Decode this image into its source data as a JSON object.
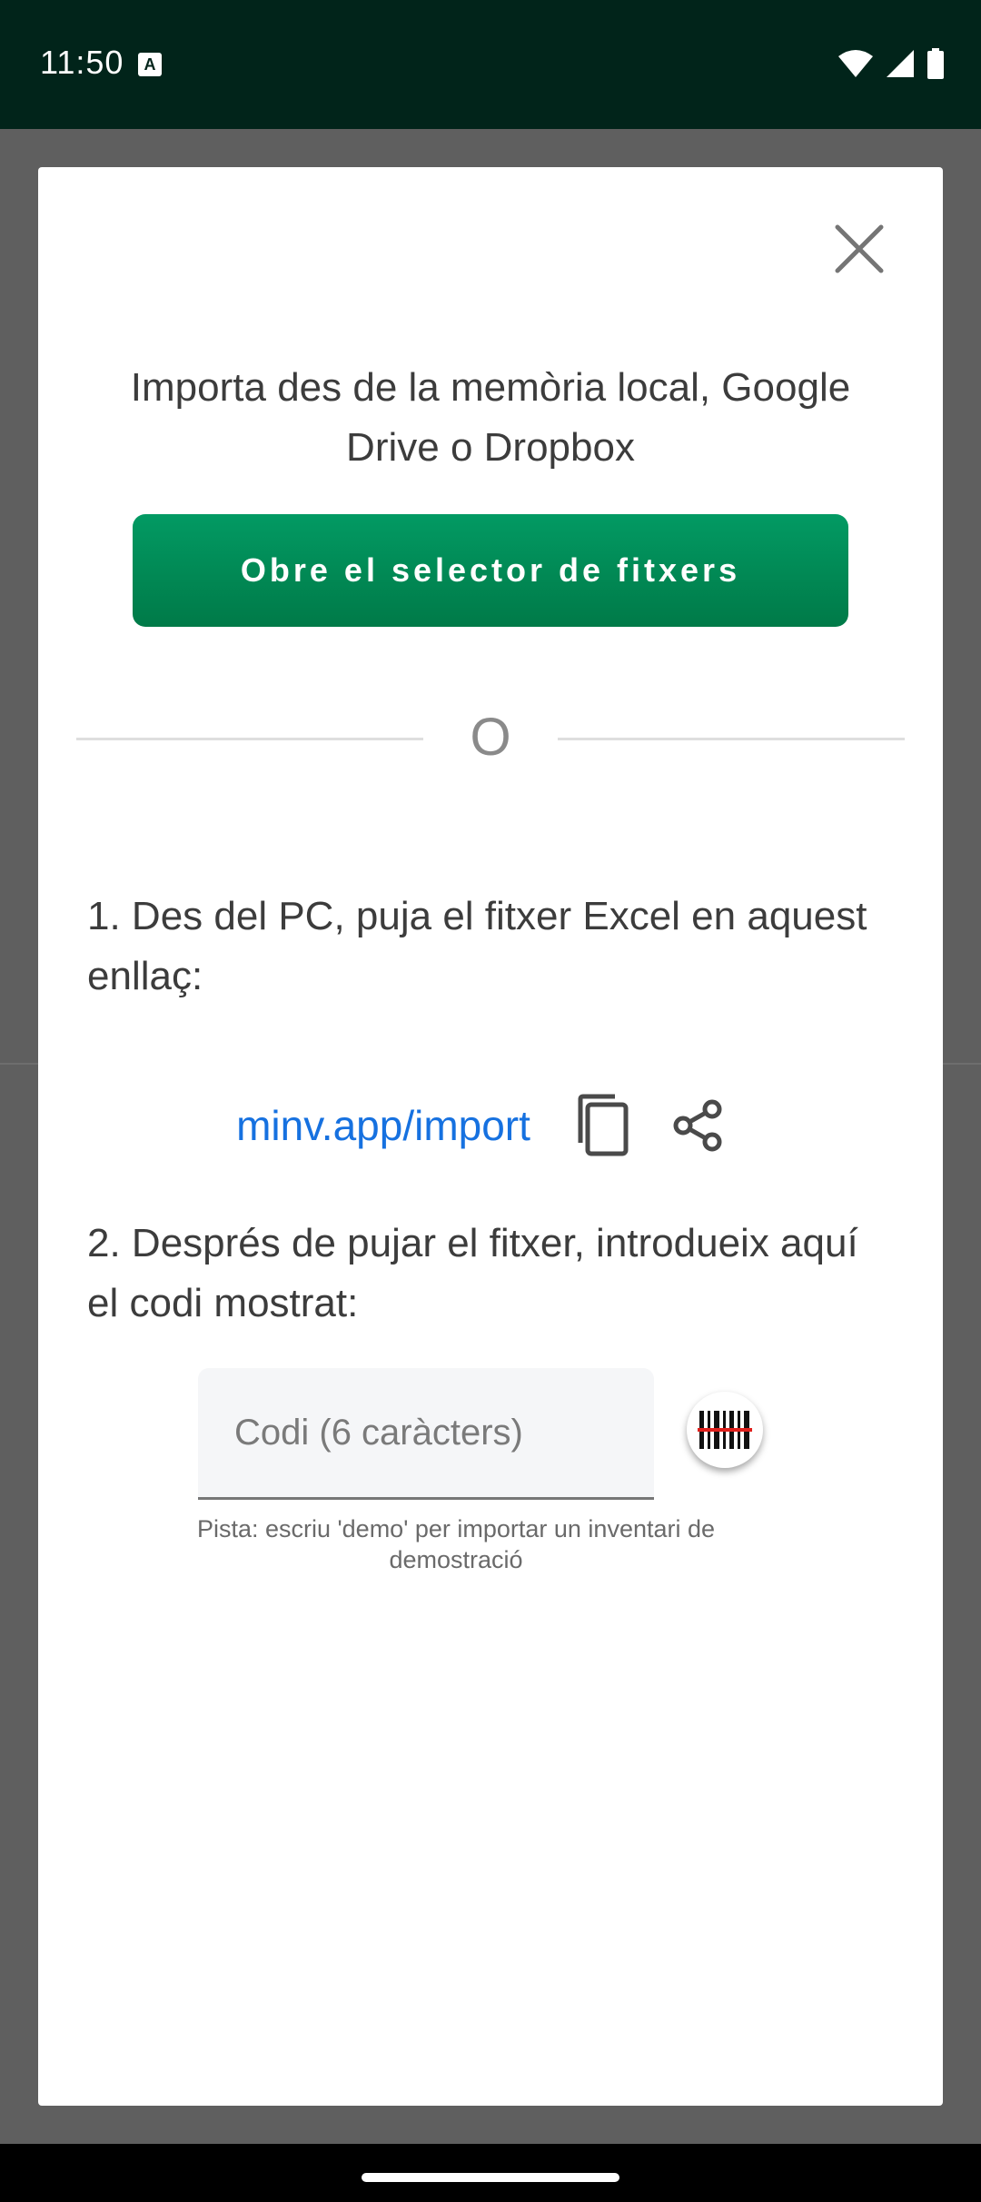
{
  "status_bar": {
    "time": "11:50",
    "notification_badge": "A"
  },
  "dialog": {
    "close_icon": "close-icon",
    "title": "Importa des de la memòria local, Google Drive o Dropbox",
    "picker_button_label": "Obre el selector de fitxers",
    "divider_text": "O",
    "step1_text": "1. Des del PC, puja el fitxer Excel en aquest enllaç:",
    "link_text": "minv.app/import",
    "copy_icon": "copy-icon",
    "share_icon": "share-icon",
    "step2_text": "2. Després de pujar el fitxer, introdueix aquí el codi mostrat:",
    "code_input": {
      "value": "",
      "placeholder": "Codi (6 caràcters)"
    },
    "scan_icon": "barcode-scan-icon",
    "hint": "Pista: escriu 'demo' per importar un inventari de demostració"
  },
  "colors": {
    "accent_green": "#029a63",
    "link_blue": "#1671e0",
    "status_bar_bg": "#01241a"
  }
}
